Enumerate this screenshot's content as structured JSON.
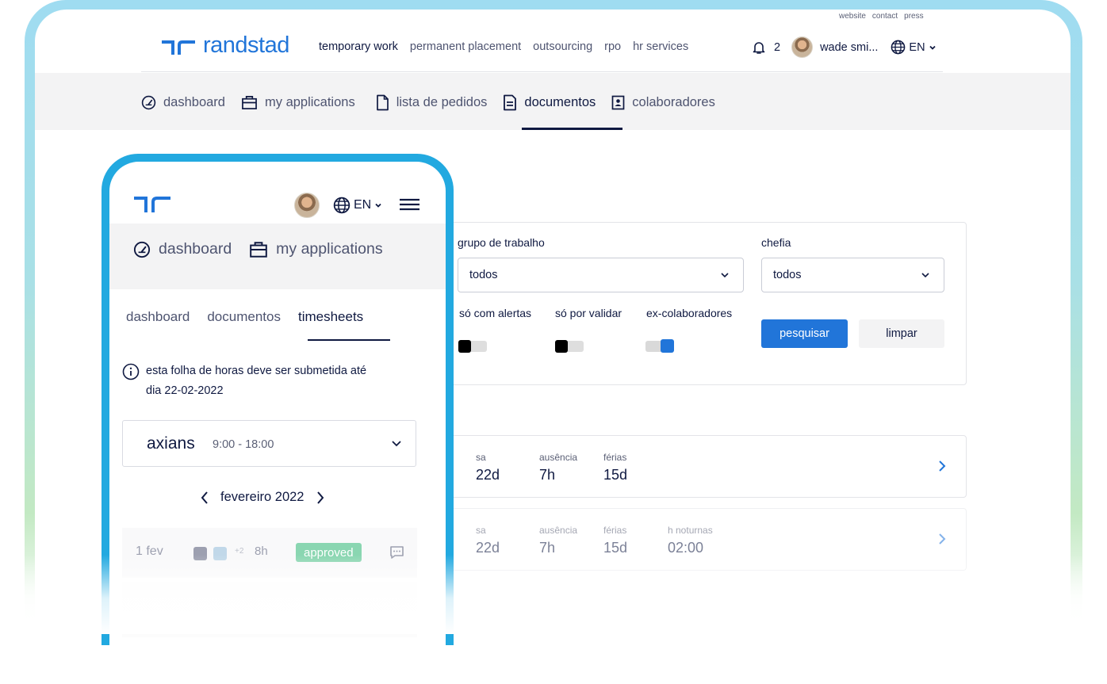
{
  "top": {
    "util_links": [
      "website",
      "contact",
      "press"
    ],
    "logo_text": "randstad",
    "nav": [
      "temporary work",
      "permanent placement",
      "outsourcing",
      "rpo",
      "hr services"
    ],
    "notifications_count": "2",
    "user_name": "wade smi...",
    "language": "EN"
  },
  "subnav": {
    "items": [
      "dashboard",
      "my applications",
      "lista de pedidos",
      "documentos",
      "colaboradores"
    ],
    "active": "documentos"
  },
  "filters": {
    "grupo_label": "grupo de trabalho",
    "grupo_value": "todos",
    "chefia_label": "chefia",
    "chefia_value": "todos",
    "toggles": [
      {
        "label": "só com alertas",
        "on": false
      },
      {
        "label": "só por validar",
        "on": false
      },
      {
        "label": "ex-colaboradores",
        "on": true
      }
    ],
    "search_button": "pesquisar",
    "clear_button": "limpar"
  },
  "summary_cards": [
    {
      "stats": [
        {
          "k": "sa",
          "v": "22d"
        },
        {
          "k": "ausência",
          "v": "7h"
        },
        {
          "k": "férias",
          "v": "15d"
        }
      ]
    },
    {
      "stats": [
        {
          "k": "sa",
          "v": "22d"
        },
        {
          "k": "ausência",
          "v": "7h"
        },
        {
          "k": "férias",
          "v": "15d"
        },
        {
          "k": "h noturnas",
          "v": "02:00"
        }
      ]
    }
  ],
  "mobile": {
    "language": "EN",
    "subnav": [
      "dashboard",
      "my applications"
    ],
    "tabs": [
      "dashboard",
      "documentos",
      "timesheets"
    ],
    "active_tab": "timesheets",
    "info_text_line1": "esta folha de horas deve ser submetida até",
    "info_text_line2": "dia 22-02-2022",
    "company": "axians",
    "hours": "9:00 - 18:00",
    "month": "fevereiro 2022",
    "row": {
      "day": "1 fev",
      "extra": "+2",
      "hours": "8h",
      "status": "approved"
    }
  },
  "colors": {
    "brand": "#2175d9",
    "navy": "#0f1941",
    "phone_frame": "#22a9e0",
    "approved": "#2bb673"
  }
}
